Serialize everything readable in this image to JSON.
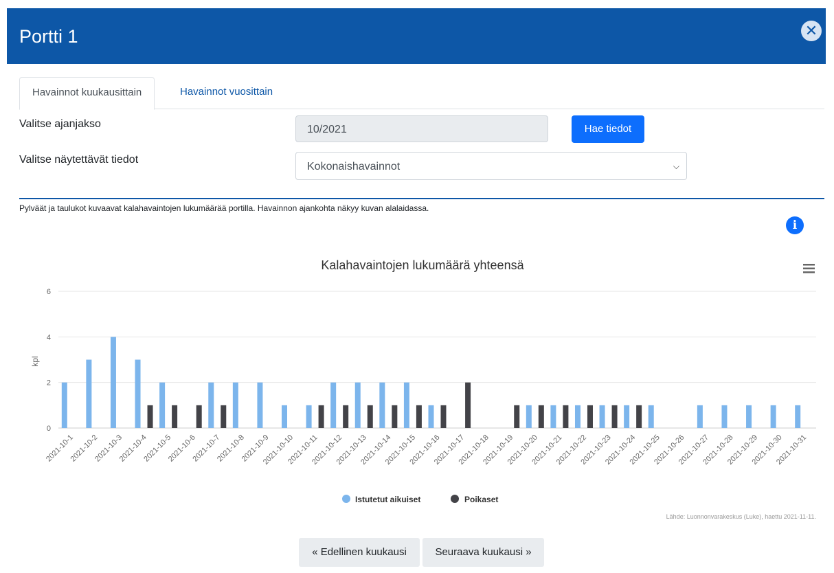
{
  "modal": {
    "title": "Portti 1"
  },
  "tabs": [
    {
      "label": "Havainnot kuukausittain",
      "active": true
    },
    {
      "label": "Havainnot vuosittain",
      "active": false
    }
  ],
  "form": {
    "period_label": "Valitse ajanjakso",
    "period_value": "10/2021",
    "fetch_button": "Hae tiedot",
    "data_label": "Valitse näytettävät tiedot",
    "data_value": "Kokonaishavainnot"
  },
  "description": "Pylväät ja taulukot kuvaavat kalahavaintojen lukumäärää portilla. Havainnon ajankohta näkyy kuvan alalaidassa.",
  "icons": {
    "close": "close-icon",
    "info": "info-icon",
    "menu": "hamburger-menu-icon",
    "chevron": "chevron-down-icon"
  },
  "colors": {
    "header": "#0d57a7",
    "primary": "#0d6efd",
    "series1": "#7cb5ec",
    "series2": "#434348"
  },
  "chart_data": {
    "type": "bar",
    "title": "Kalahavaintojen lukumäärä yhteensä",
    "ylabel": "kpl",
    "xlabel": "",
    "ylim": [
      0,
      6
    ],
    "yticks": [
      0,
      2,
      4,
      6
    ],
    "grid": true,
    "legend_position": "bottom",
    "categories": [
      "2021-10-1",
      "2021-10-2",
      "2021-10-3",
      "2021-10-4",
      "2021-10-5",
      "2021-10-6",
      "2021-10-7",
      "2021-10-8",
      "2021-10-9",
      "2021-10-10",
      "2021-10-11",
      "2021-10-12",
      "2021-10-13",
      "2021-10-14",
      "2021-10-15",
      "2021-10-16",
      "2021-10-17",
      "2021-10-18",
      "2021-10-19",
      "2021-10-20",
      "2021-10-21",
      "2021-10-22",
      "2021-10-23",
      "2021-10-24",
      "2021-10-25",
      "2021-10-26",
      "2021-10-27",
      "2021-10-28",
      "2021-10-29",
      "2021-10-30",
      "2021-10-31"
    ],
    "series": [
      {
        "name": "Istutetut aikuiset",
        "color": "#7cb5ec",
        "values": [
          2,
          3,
          4,
          3,
          2,
          0,
          2,
          2,
          2,
          1,
          1,
          2,
          2,
          2,
          2,
          1,
          0,
          0,
          0,
          1,
          1,
          1,
          1,
          1,
          1,
          0,
          1,
          1,
          1,
          1,
          1
        ]
      },
      {
        "name": "Poikaset",
        "color": "#434348",
        "values": [
          0,
          0,
          0,
          1,
          1,
          1,
          1,
          0,
          0,
          0,
          1,
          1,
          1,
          1,
          1,
          1,
          2,
          0,
          1,
          1,
          1,
          1,
          1,
          1,
          0,
          0,
          0,
          0,
          0,
          0,
          0
        ]
      }
    ],
    "credits": "Lähde: Luonnonvarakeskus (Luke), haettu 2021-11-11."
  },
  "nav": {
    "prev": "« Edellinen kuukausi",
    "next": "Seuraava kuukausi »"
  }
}
